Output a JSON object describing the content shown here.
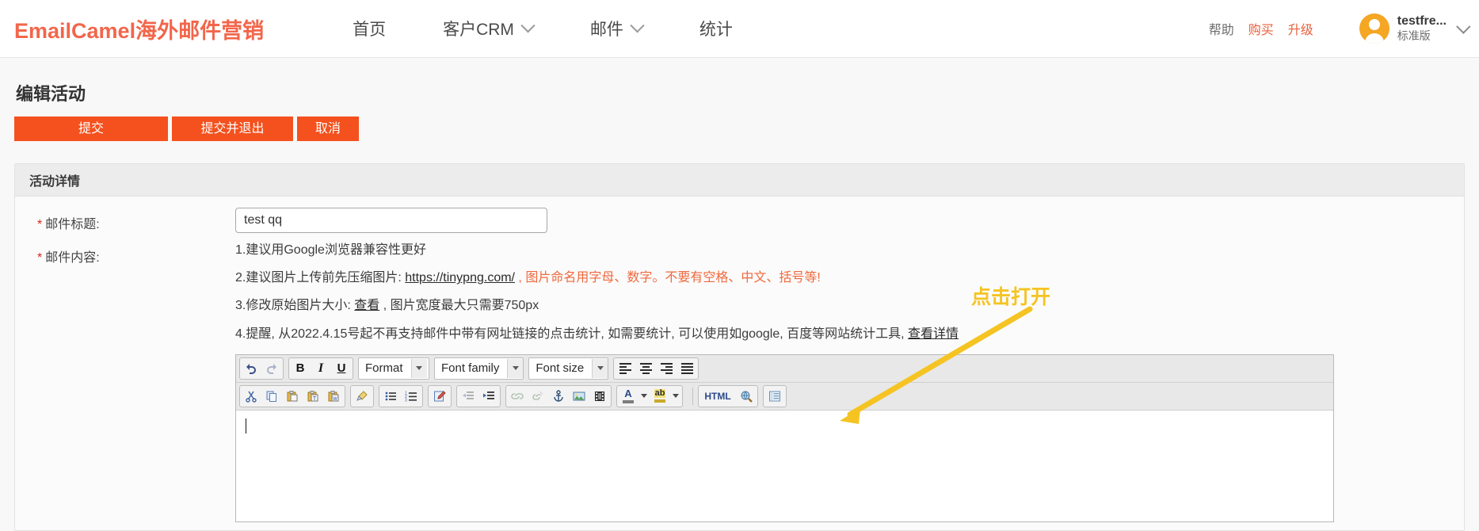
{
  "header": {
    "brand": "EmailCamel海外邮件营销",
    "nav": [
      {
        "label": "首页",
        "has_caret": false
      },
      {
        "label": "客户CRM",
        "has_caret": true
      },
      {
        "label": "邮件",
        "has_caret": true
      },
      {
        "label": "统计",
        "has_caret": false
      }
    ],
    "links": [
      {
        "label": "帮助",
        "accent": false
      },
      {
        "label": "购买",
        "accent": true
      },
      {
        "label": "升级",
        "accent": true
      }
    ],
    "user": {
      "name": "testfre...",
      "plan": "标准版"
    }
  },
  "page": {
    "title": "编辑活动",
    "buttons": {
      "submit": "提交",
      "submit_exit": "提交并退出",
      "cancel": "取消"
    },
    "panel_title": "活动详情"
  },
  "form": {
    "subject_label": "邮件标题:",
    "subject_value": "test qq",
    "subject_placeholder": "",
    "content_label": "邮件内容:",
    "required_mark": "*"
  },
  "tips": {
    "line1": "1.建议用Google浏览器兼容性更好",
    "line2_prefix": "2.建议图片上传前先压缩图片: ",
    "line2_link": "https://tinypng.com/",
    "line2_suffix": " , 图片命名用字母、数字。不要有空格、中文、括号等!",
    "line3_prefix": "3.修改原始图片大小: ",
    "line3_link": "查看",
    "line3_suffix": " , 图片宽度最大只需要750px",
    "line4_prefix": "4.提醒, 从2022.4.15号起不再支持邮件中带有网址链接的点击统计, 如需要统计, 可以使用如google, 百度等网站统计工具, ",
    "line4_link": "查看详情"
  },
  "editor": {
    "row1": {
      "undo_icon": "undo-icon",
      "redo_icon": "redo-icon",
      "bold": "B",
      "italic": "I",
      "underline": "U",
      "format_select": "Format",
      "fontfamily_select": "Font family",
      "fontsize_select": "Font size",
      "align_left_icon": "align-left-icon",
      "align_center_icon": "align-center-icon",
      "align_right_icon": "align-right-icon",
      "align_justify_icon": "align-justify-icon"
    },
    "row2": {
      "cut_icon": "cut-icon",
      "copy_icon": "copy-icon",
      "paste_icon": "paste-icon",
      "paste_text_icon": "paste-as-text-icon",
      "paste_word_icon": "paste-from-word-icon",
      "cleanup_icon": "cleanup-icon",
      "bullet_list_icon": "bullet-list-icon",
      "numbered_list_icon": "numbered-list-icon",
      "edit_icon": "edit-icon",
      "outdent_icon": "outdent-icon",
      "indent_icon": "indent-icon",
      "link_icon": "link-icon",
      "unlink_icon": "unlink-icon",
      "anchor_icon": "anchor-icon",
      "image_icon": "image-icon",
      "media_icon": "media-icon",
      "forecolor_label": "A",
      "backcolor_label": "ab",
      "html_label": "HTML",
      "preview_icon": "preview-icon",
      "template_icon": "template-icon"
    },
    "content": ""
  },
  "annotation": {
    "label": "点击打开",
    "color": "#f5c423"
  },
  "colors": {
    "brand": "#f2664b",
    "button": "#f4511e",
    "warn_text": "#ef6a3e",
    "required": "#e0231a",
    "annotation": "#f5c423",
    "page_bg": "#f8f8f8"
  }
}
